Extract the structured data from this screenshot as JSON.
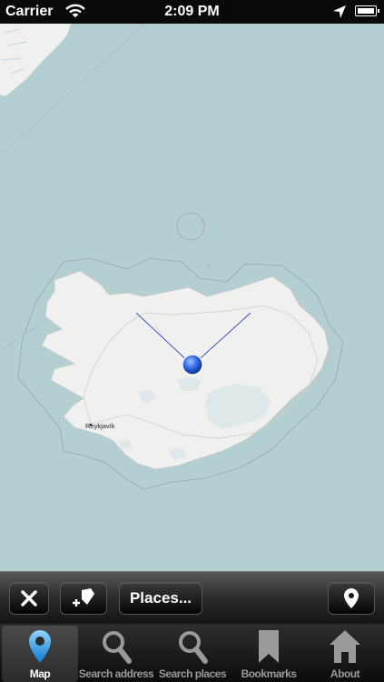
{
  "status_bar": {
    "carrier": "Carrier",
    "time": "2:09 PM"
  },
  "map": {
    "city_label": "Reykjavík",
    "sea_color": "#b3cfd1",
    "land_color": "#f0f0ee"
  },
  "toolbar": {
    "places_label": "Places..."
  },
  "tabs": [
    {
      "label": "Map",
      "icon": "map-pin-icon",
      "active": true
    },
    {
      "label": "Search address",
      "icon": "search-icon",
      "active": false
    },
    {
      "label": "Search places",
      "icon": "search-icon",
      "active": false
    },
    {
      "label": "Bookmarks",
      "icon": "bookmark-icon",
      "active": false
    },
    {
      "label": "About",
      "icon": "home-icon",
      "active": false
    }
  ]
}
